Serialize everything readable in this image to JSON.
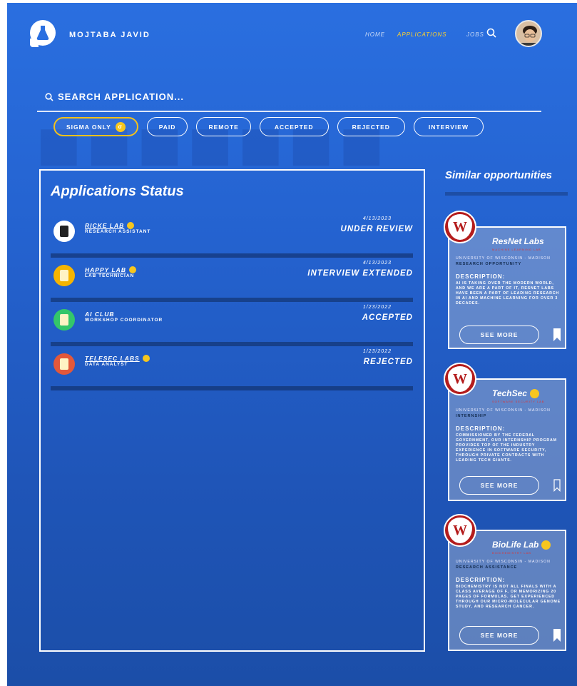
{
  "header": {
    "username": "MOJTABA JAVID",
    "nav": {
      "home": "HOME",
      "applications": "APPLICATIONS",
      "jobs": "JOBS"
    }
  },
  "search": {
    "label": "SEARCH APPLICATION..."
  },
  "filters": [
    "SIGMA ONLY",
    "PAID",
    "REMOTE",
    "ACCEPTED",
    "REJECTED",
    "INTERVIEW"
  ],
  "status": {
    "title": "Applications Status",
    "items": [
      {
        "name": "RICKE LAB",
        "role": "RESEARCH ASSISTANT",
        "date": "4/13/2023",
        "status": "UNDER REVIEW",
        "icon_color": "#ffffff",
        "sigma": true
      },
      {
        "name": "HAPPY LAB",
        "role": "LAB TECHNICIAN",
        "date": "4/13/2023",
        "status": "INTERVIEW EXTENDED",
        "icon_color": "#f5b400",
        "sigma": true
      },
      {
        "name": "AI CLUB",
        "role": "WORKSHOP COORDINATOR",
        "date": "1/23/2022",
        "status": "ACCEPTED",
        "icon_color": "#34c66a",
        "sigma": false
      },
      {
        "name": "TELESEC LABS",
        "role": "DATA ANALYST",
        "date": "1/23/2022",
        "status": "REJECTED",
        "icon_color": "#e2583b",
        "sigma": true
      }
    ]
  },
  "similar": {
    "title": "Similar opportunities",
    "cards": [
      {
        "name": "ResNet Labs",
        "sub": "MACHINE LEARNING LAB",
        "university": "UNIVERSITY OF WISCONSIN - MADISON",
        "type": "RESEARCH OPPORTUNITY",
        "desc_label": "DESCRIPTION:",
        "desc": "AI is taking over the modern world, and we are a part of it, ResNet labs have been a part of leading research in AI and machine learning for over 3 decades.",
        "button": "SEE MORE",
        "bookmarked": true
      },
      {
        "name": "TechSec",
        "sub": "SOFTWARE SECURITY LAB",
        "university": "UNIVERSITY OF WISCONSIN - MADISON",
        "type": "INTERNSHIP",
        "desc_label": "DESCRIPTION:",
        "desc": "Commissioned by the federal government, our internship program provides top of the industry experience in software security, through private contracts with leading tech giants.",
        "button": "SEE MORE",
        "bookmarked": false
      },
      {
        "name": "BioLife Lab",
        "sub": "BIOCHEMISTRY LAB",
        "university": "UNIVERSITY OF WISCONSIN - MADISON",
        "type": "RESEARCH ASSISTANCE",
        "desc_label": "DESCRIPTION:",
        "desc": "Biochemistry is not all finals with a class average of F, or memorizing 20 pages of formulas. Get experienced through our micro-molecular genome study, and research cancer.",
        "button": "SEE MORE",
        "bookmarked": true
      }
    ]
  },
  "colors": {
    "accent": "#ffd22b",
    "sigma": "#f6c61e",
    "seal": "#b41c1c"
  }
}
